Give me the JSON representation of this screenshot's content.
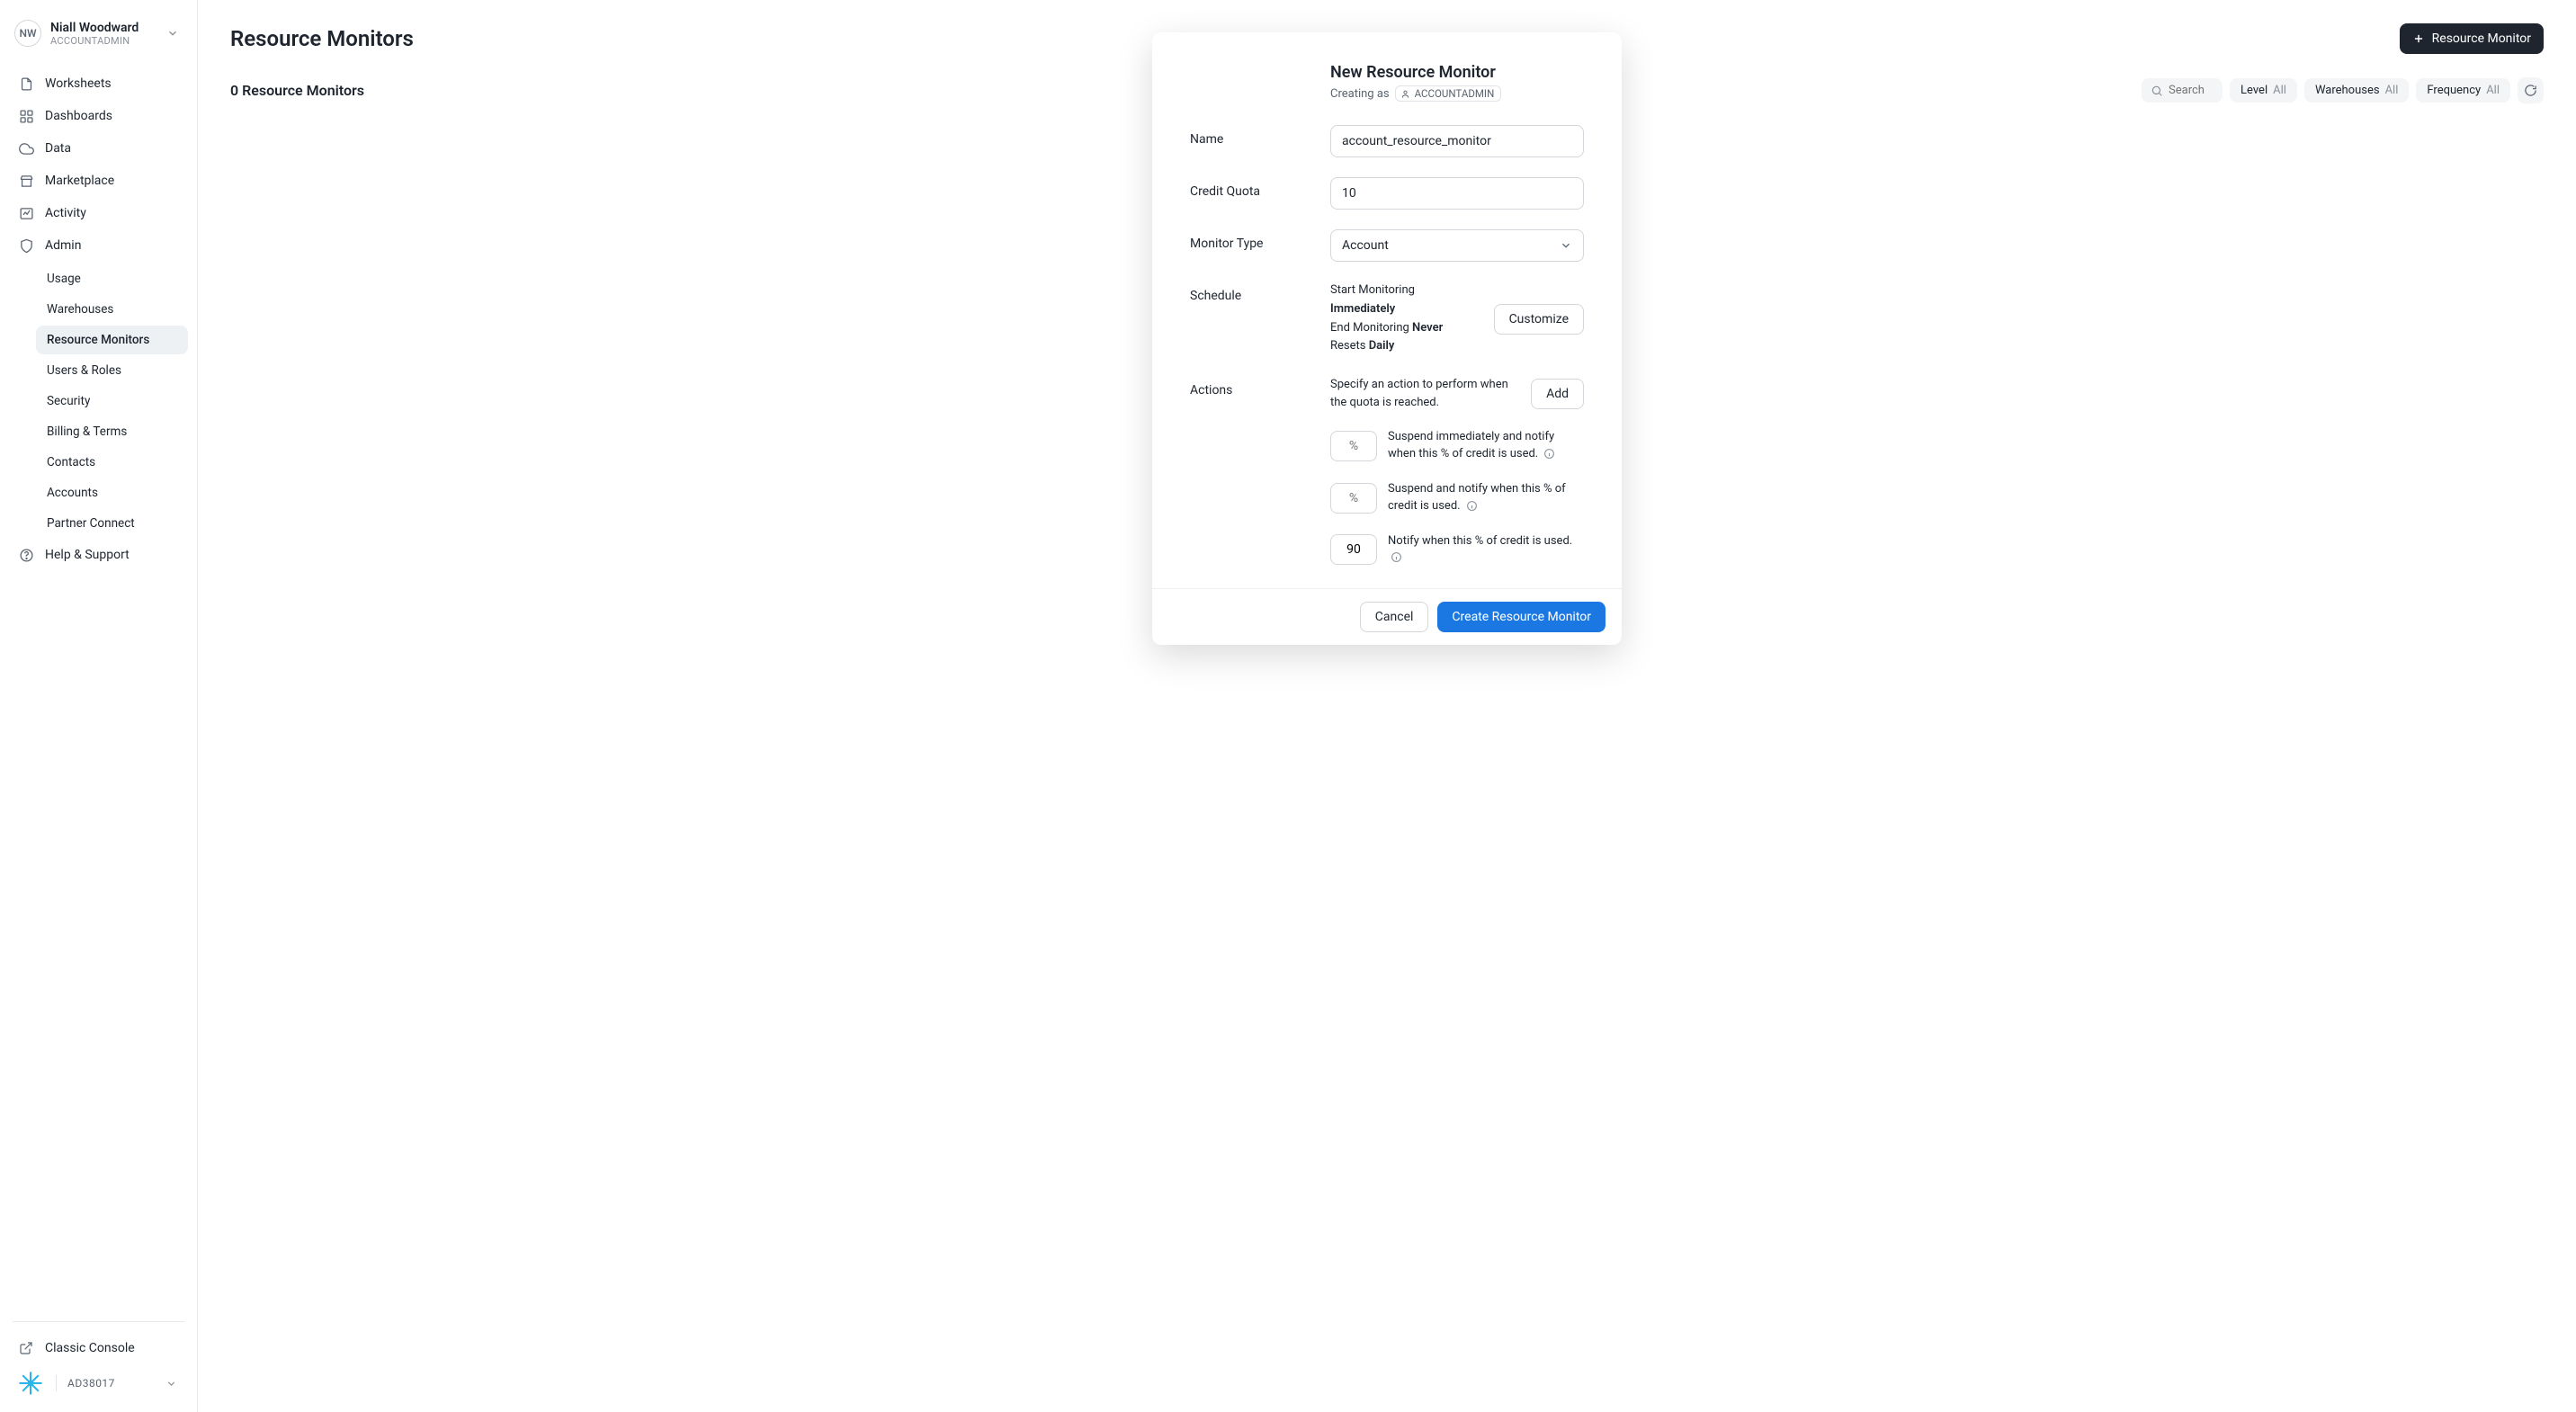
{
  "user": {
    "initials": "NW",
    "name": "Niall Woodward",
    "role": "ACCOUNTADMIN"
  },
  "nav": {
    "worksheets": "Worksheets",
    "dashboards": "Dashboards",
    "data": "Data",
    "marketplace": "Marketplace",
    "activity": "Activity",
    "admin": "Admin",
    "help": "Help & Support",
    "classic": "Classic Console"
  },
  "adminSub": {
    "usage": "Usage",
    "warehouses": "Warehouses",
    "resourceMonitors": "Resource Monitors",
    "usersRoles": "Users & Roles",
    "security": "Security",
    "billing": "Billing & Terms",
    "contacts": "Contacts",
    "accounts": "Accounts",
    "partner": "Partner Connect"
  },
  "accountId": "AD38017",
  "page": {
    "title": "Resource Monitors",
    "newButton": "Resource Monitor",
    "countLabel": "0 Resource Monitors",
    "searchPlaceholder": "Search",
    "filters": {
      "levelLabel": "Level",
      "levelValue": "All",
      "warehousesLabel": "Warehouses",
      "warehousesValue": "All",
      "frequencyLabel": "Frequency",
      "frequencyValue": "All"
    }
  },
  "modal": {
    "title": "New Resource Monitor",
    "creatingAs": "Creating as",
    "creatingRole": "ACCOUNTADMIN",
    "labels": {
      "name": "Name",
      "creditQuota": "Credit Quota",
      "monitorType": "Monitor Type",
      "schedule": "Schedule",
      "actions": "Actions"
    },
    "fields": {
      "name": "account_resource_monitor",
      "creditQuota": "10",
      "monitorType": "Account"
    },
    "schedule": {
      "startLabel": "Start Monitoring ",
      "startValue": "Immediately",
      "endLabel": "End Monitoring ",
      "endValue": "Never",
      "resetsLabel": "Resets ",
      "resetsValue": "Daily",
      "customize": "Customize"
    },
    "actions": {
      "description": "Specify an action to perform when the quota is reached.",
      "addButton": "Add",
      "row1": {
        "placeholder": "%",
        "value": "",
        "text": "Suspend immediately and notify when this % of credit is used."
      },
      "row2": {
        "placeholder": "%",
        "value": "",
        "text": "Suspend and notify when this % of credit is used."
      },
      "row3": {
        "placeholder": "%",
        "value": "90",
        "text": "Notify when this % of credit is used."
      }
    },
    "footer": {
      "cancel": "Cancel",
      "create": "Create Resource Monitor"
    }
  }
}
